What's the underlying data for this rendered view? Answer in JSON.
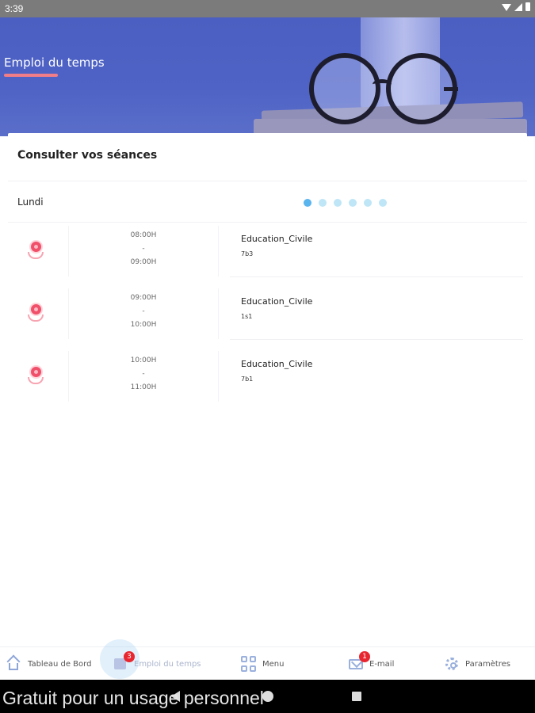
{
  "status_bar": {
    "time": "3:39"
  },
  "header": {
    "title": "Emploi du temps"
  },
  "main": {
    "section_title": "Consulter vos séances",
    "day": "Lundi",
    "day_pager": {
      "count": 6,
      "active_index": 0
    },
    "sessions": [
      {
        "start": "08:00H",
        "sep": "-",
        "end": "09:00H",
        "subject": "Education_Civile",
        "group": "7b3"
      },
      {
        "start": "09:00H",
        "sep": "-",
        "end": "10:00H",
        "subject": "Education_Civile",
        "group": "1s1"
      },
      {
        "start": "10:00H",
        "sep": "-",
        "end": "11:00H",
        "subject": "Education_Civile",
        "group": "7b1"
      }
    ]
  },
  "bottom_nav": {
    "items": [
      {
        "label": "Tableau de Bord",
        "icon": "home-icon"
      },
      {
        "label": "Emploi du temps",
        "icon": "calendar-icon",
        "badge": "3",
        "active": true
      },
      {
        "label": "Menu",
        "icon": "grid-icon"
      },
      {
        "label": "E-mail",
        "icon": "mail-icon",
        "badge": "1"
      },
      {
        "label": "Paramètres",
        "icon": "gear-icon"
      }
    ]
  },
  "watermark": "Gratuit pour un usage personnel",
  "colors": {
    "header": "#4b5fc2",
    "accent_underline": "#f07d88",
    "dot_active": "#5ab4ee",
    "dot_inactive": "#bfe6f6",
    "badge": "#e8262f",
    "pin": "#f0506a"
  }
}
